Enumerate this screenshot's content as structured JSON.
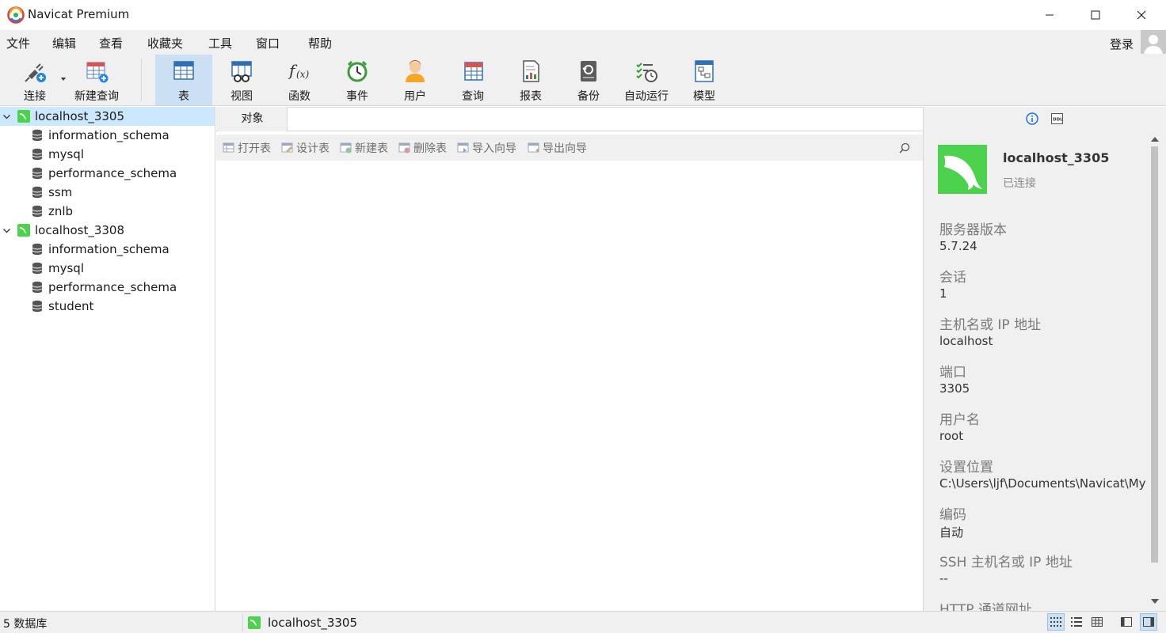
{
  "window": {
    "title": "Navicat Premium"
  },
  "menu": {
    "items": [
      "文件",
      "编辑",
      "查看",
      "收藏夹",
      "工具",
      "窗口",
      "帮助"
    ],
    "login_label": "登录"
  },
  "toolbar": {
    "buttons": [
      {
        "label": "连接",
        "icon": "plug-icon"
      },
      {
        "label": "新建查询",
        "icon": "new-query-icon"
      },
      {
        "label": "表",
        "icon": "table-icon",
        "active": true
      },
      {
        "label": "视图",
        "icon": "view-icon"
      },
      {
        "label": "函数",
        "icon": "function-icon"
      },
      {
        "label": "事件",
        "icon": "clock-icon"
      },
      {
        "label": "用户",
        "icon": "user-icon"
      },
      {
        "label": "查询",
        "icon": "query-icon"
      },
      {
        "label": "报表",
        "icon": "report-icon"
      },
      {
        "label": "备份",
        "icon": "backup-icon"
      },
      {
        "label": "自动运行",
        "icon": "schedule-icon"
      },
      {
        "label": "模型",
        "icon": "model-icon"
      }
    ]
  },
  "tree": {
    "connections": [
      {
        "name": "localhost_3305",
        "selected": true,
        "databases": [
          "information_schema",
          "mysql",
          "performance_schema",
          "ssm",
          "znlb"
        ]
      },
      {
        "name": "localhost_3308",
        "selected": false,
        "databases": [
          "information_schema",
          "mysql",
          "performance_schema",
          "student"
        ]
      }
    ]
  },
  "center": {
    "tab_label": "对象",
    "actions": [
      "打开表",
      "设计表",
      "新建表",
      "删除表",
      "导入向导",
      "导出向导"
    ]
  },
  "info": {
    "connection_name": "localhost_3305",
    "status": "已连接",
    "fields": [
      {
        "label": "服务器版本",
        "value": "5.7.24"
      },
      {
        "label": "会话",
        "value": "1"
      },
      {
        "label": "主机名或 IP 地址",
        "value": "localhost"
      },
      {
        "label": "端口",
        "value": "3305"
      },
      {
        "label": "用户名",
        "value": "root"
      },
      {
        "label": "设置位置",
        "value": "C:\\Users\\ljf\\Documents\\Navicat\\My"
      },
      {
        "label": "编码",
        "value": "自动"
      },
      {
        "label": "SSH 主机名或 IP 地址",
        "value": "--"
      },
      {
        "label": "HTTP 通道网址",
        "value": ""
      }
    ]
  },
  "statusbar": {
    "count_text": "5 数据库",
    "connection": "localhost_3305"
  },
  "colors": {
    "accent": "#cce0f3",
    "selection": "#cce8ff",
    "mysql_green": "#4cd24c",
    "info_blue": "#1a73e8"
  }
}
